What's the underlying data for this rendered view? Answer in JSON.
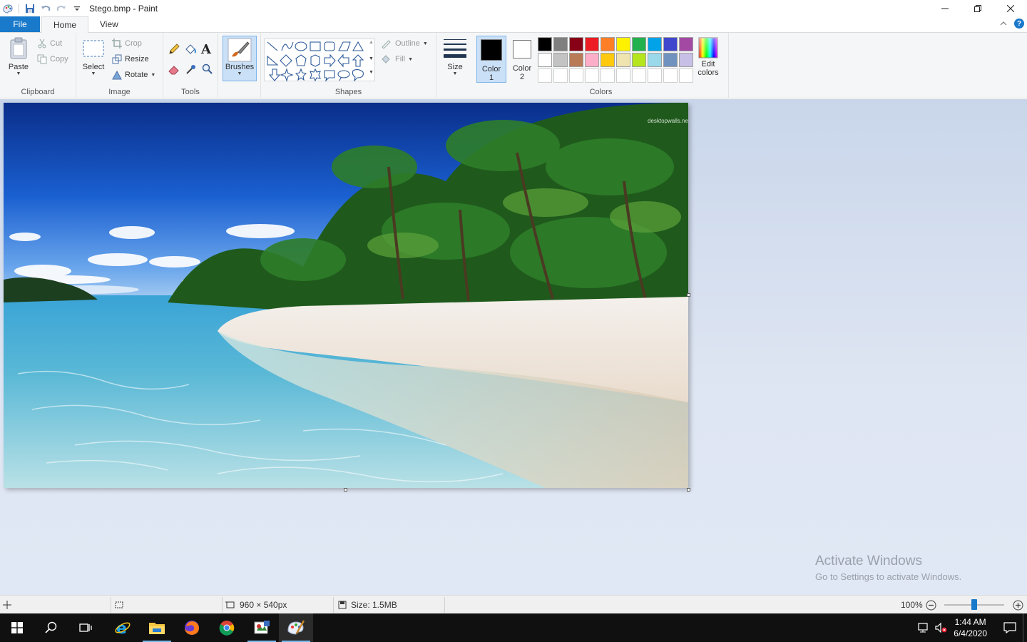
{
  "window": {
    "title": "Stego.bmp - Paint"
  },
  "tabs": {
    "file": "File",
    "home": "Home",
    "view": "View"
  },
  "clipboard": {
    "paste": "Paste",
    "cut": "Cut",
    "copy": "Copy",
    "label": "Clipboard"
  },
  "image": {
    "select": "Select",
    "crop": "Crop",
    "resize": "Resize",
    "rotate": "Rotate",
    "label": "Image"
  },
  "tools": {
    "label": "Tools"
  },
  "brushes": {
    "label": "Brushes"
  },
  "shapes": {
    "outline": "Outline",
    "fill": "Fill",
    "label": "Shapes"
  },
  "size": {
    "label": "Size"
  },
  "colors": {
    "color1_label": "Color",
    "color1_num": "1",
    "color2_label": "Color",
    "color2_num": "2",
    "edit_l1": "Edit",
    "edit_l2": "colors",
    "label": "Colors",
    "palette_row1": [
      "#000000",
      "#7f7f7f",
      "#880015",
      "#ed1c24",
      "#ff7f27",
      "#fff200",
      "#22b14c",
      "#00a2e8",
      "#3f48cc",
      "#a349a4"
    ],
    "palette_row2": [
      "#ffffff",
      "#c3c3c3",
      "#b97a57",
      "#ffaec9",
      "#ffc90e",
      "#efe4b0",
      "#b5e61d",
      "#99d9ea",
      "#7092be",
      "#c8bfe7"
    ]
  },
  "canvas": {
    "watermark_text": "desktopwalls.net"
  },
  "activation": {
    "line1": "Activate Windows",
    "line2": "Go to Settings to activate Windows."
  },
  "status": {
    "dimensions": "960 × 540px",
    "size": "Size: 1.5MB",
    "zoom": "100%",
    "zoom_level": 100
  },
  "taskbar": {
    "time": "1:44 AM",
    "date": "6/4/2020"
  }
}
